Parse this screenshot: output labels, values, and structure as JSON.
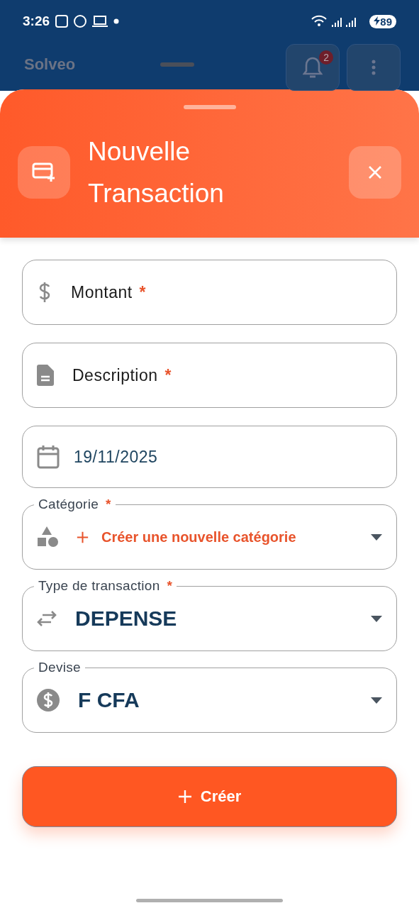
{
  "status_bar": {
    "time": "3:26",
    "battery": "89"
  },
  "app_bar": {
    "logo": "Solveo",
    "notification_count": "2"
  },
  "sheet": {
    "title": "Nouvelle Transaction",
    "fields": [
      {
        "kind": "input",
        "label": "Montant",
        "required_mark": "*"
      },
      {
        "kind": "input",
        "label": "Description",
        "required_mark": "*"
      },
      {
        "kind": "date",
        "value": "19/11/2025"
      },
      {
        "kind": "select_action",
        "label": "Catégorie",
        "required_mark": "*",
        "value": "Créer une nouvelle catégorie"
      },
      {
        "kind": "select",
        "label": "Type de transaction",
        "required_mark": "*",
        "value": "DEPENSE"
      },
      {
        "kind": "select",
        "label": "Devise",
        "value": "F CFA"
      }
    ],
    "submit": {
      "label": "Créer"
    }
  }
}
